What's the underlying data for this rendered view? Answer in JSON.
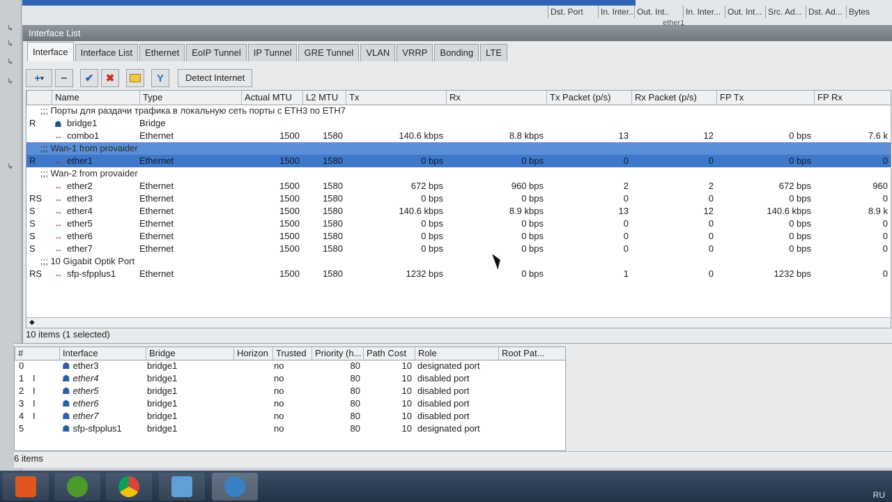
{
  "background_window": {
    "columns": [
      "Dst. Port",
      "In. Inter...",
      "Out. Int...",
      "In. Inter...",
      "Out. Int...",
      "Src. Ad...",
      "Dst. Ad...",
      "Bytes"
    ],
    "partial_cell": "ether1"
  },
  "window": {
    "title": "Interface List",
    "tabs": [
      "Interface",
      "Interface List",
      "Ethernet",
      "EoIP Tunnel",
      "IP Tunnel",
      "GRE Tunnel",
      "VLAN",
      "VRRP",
      "Bonding",
      "LTE"
    ],
    "active_tab": "Interface",
    "toolbar": {
      "add_label": "+",
      "remove_label": "−",
      "enable_label": "✔",
      "disable_label": "✖",
      "filter_label": "Y",
      "detect_label": "Detect Internet"
    }
  },
  "interfaces": {
    "columns": [
      "Name",
      "Type",
      "Actual MTU",
      "L2 MTU",
      "Tx",
      "Rx",
      "Tx Packet (p/s)",
      "Rx Packet (p/s)",
      "FP Tx",
      "FP Rx"
    ],
    "rows": [
      {
        "kind": "comment",
        "text": ";;; Порты для раздачи трафика в локальную сеть порты с ETH3 по ETH7"
      },
      {
        "kind": "iface",
        "flag": "R",
        "name": "bridge1",
        "icon": "bridge-icon",
        "type": "Bridge",
        "mtu": "",
        "l2mtu": "",
        "tx": "",
        "rx": "",
        "txp": "",
        "rxp": "",
        "fptx": "",
        "fprx": ""
      },
      {
        "kind": "iface",
        "flag": "",
        "name": "combo1",
        "icon": "ethernet-icon",
        "type": "Ethernet",
        "mtu": "1500",
        "l2mtu": "1580",
        "tx": "140.6 kbps",
        "rx": "8.8 kbps",
        "txp": "13",
        "rxp": "12",
        "fptx": "0 bps",
        "fprx": "7.6 k"
      },
      {
        "kind": "comment",
        "text": ";;; Wan-1 from provaider",
        "selected": true
      },
      {
        "kind": "iface",
        "flag": "R",
        "name": "ether1",
        "icon": "ethernet-icon",
        "type": "Ethernet",
        "mtu": "1500",
        "l2mtu": "1580",
        "tx": "0 bps",
        "rx": "0 bps",
        "txp": "0",
        "rxp": "0",
        "fptx": "0 bps",
        "fprx": "0",
        "selected": true
      },
      {
        "kind": "comment",
        "text": ";;; Wan-2 from provaider"
      },
      {
        "kind": "iface",
        "flag": "",
        "name": "ether2",
        "icon": "ethernet-icon",
        "type": "Ethernet",
        "mtu": "1500",
        "l2mtu": "1580",
        "tx": "672 bps",
        "rx": "960 bps",
        "txp": "2",
        "rxp": "2",
        "fptx": "672 bps",
        "fprx": "960"
      },
      {
        "kind": "iface",
        "flag": "RS",
        "name": "ether3",
        "icon": "ethernet-icon",
        "type": "Ethernet",
        "mtu": "1500",
        "l2mtu": "1580",
        "tx": "0 bps",
        "rx": "0 bps",
        "txp": "0",
        "rxp": "0",
        "fptx": "0 bps",
        "fprx": "0"
      },
      {
        "kind": "iface",
        "flag": "S",
        "name": "ether4",
        "icon": "ethernet-icon",
        "type": "Ethernet",
        "mtu": "1500",
        "l2mtu": "1580",
        "tx": "140.6 kbps",
        "rx": "8.9 kbps",
        "txp": "13",
        "rxp": "12",
        "fptx": "140.6 kbps",
        "fprx": "8.9 k"
      },
      {
        "kind": "iface",
        "flag": "S",
        "name": "ether5",
        "icon": "ethernet-icon",
        "type": "Ethernet",
        "mtu": "1500",
        "l2mtu": "1580",
        "tx": "0 bps",
        "rx": "0 bps",
        "txp": "0",
        "rxp": "0",
        "fptx": "0 bps",
        "fprx": "0"
      },
      {
        "kind": "iface",
        "flag": "S",
        "name": "ether6",
        "icon": "ethernet-icon",
        "type": "Ethernet",
        "mtu": "1500",
        "l2mtu": "1580",
        "tx": "0 bps",
        "rx": "0 bps",
        "txp": "0",
        "rxp": "0",
        "fptx": "0 bps",
        "fprx": "0"
      },
      {
        "kind": "iface",
        "flag": "S",
        "name": "ether7",
        "icon": "ethernet-icon",
        "type": "Ethernet",
        "mtu": "1500",
        "l2mtu": "1580",
        "tx": "0 bps",
        "rx": "0 bps",
        "txp": "0",
        "rxp": "0",
        "fptx": "0 bps",
        "fprx": "0"
      },
      {
        "kind": "comment",
        "text": ";;; 10 Gigabit Optik Port"
      },
      {
        "kind": "iface",
        "flag": "RS",
        "name": "sfp-sfpplus1",
        "icon": "ethernet-icon",
        "type": "Ethernet",
        "mtu": "1500",
        "l2mtu": "1580",
        "tx": "1232 bps",
        "rx": "0 bps",
        "txp": "1",
        "rxp": "0",
        "fptx": "1232 bps",
        "fprx": "0"
      }
    ],
    "status": "10 items (1 selected)"
  },
  "bridge_ports": {
    "columns": [
      "#",
      "Interface",
      "Bridge",
      "Horizon",
      "Trusted",
      "Priority (h...",
      "Path Cost",
      "Role",
      "Root Pat..."
    ],
    "rows": [
      {
        "num": "0",
        "flag": "",
        "iface": "ether3",
        "italic": false,
        "bridge": "bridge1",
        "horizon": "",
        "trusted": "no",
        "priority": "80",
        "cost": "10",
        "role": "designated port"
      },
      {
        "num": "1",
        "flag": "I",
        "iface": "ether4",
        "italic": true,
        "bridge": "bridge1",
        "horizon": "",
        "trusted": "no",
        "priority": "80",
        "cost": "10",
        "role": "disabled port"
      },
      {
        "num": "2",
        "flag": "I",
        "iface": "ether5",
        "italic": true,
        "bridge": "bridge1",
        "horizon": "",
        "trusted": "no",
        "priority": "80",
        "cost": "10",
        "role": "disabled port"
      },
      {
        "num": "3",
        "flag": "I",
        "iface": "ether6",
        "italic": true,
        "bridge": "bridge1",
        "horizon": "",
        "trusted": "no",
        "priority": "80",
        "cost": "10",
        "role": "disabled port"
      },
      {
        "num": "4",
        "flag": "I",
        "iface": "ether7",
        "italic": true,
        "bridge": "bridge1",
        "horizon": "",
        "trusted": "no",
        "priority": "80",
        "cost": "10",
        "role": "disabled port"
      },
      {
        "num": "5",
        "flag": "",
        "iface": "sfp-sfpplus1",
        "italic": false,
        "bridge": "bridge1",
        "horizon": "",
        "trusted": "no",
        "priority": "80",
        "cost": "10",
        "role": "designated port"
      }
    ],
    "status": "6 items"
  },
  "taskbar": {
    "apps": [
      "media-player-icon",
      "utorrent-icon",
      "chrome-icon",
      "control-panel-icon",
      "winbox-icon"
    ],
    "tray_lang": "RU"
  },
  "colors": {
    "selection": "#3f78c9",
    "accent": "#1d5fc0"
  }
}
